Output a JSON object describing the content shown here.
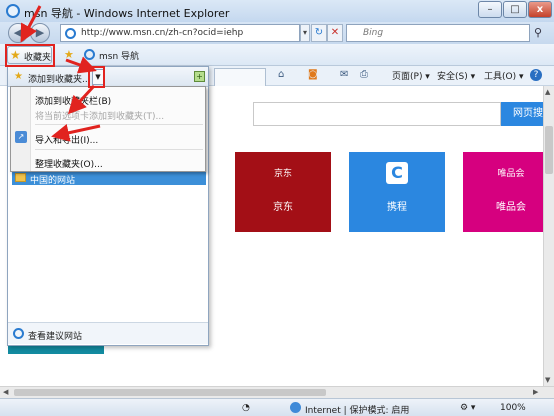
{
  "window": {
    "title": "msn 导航 - Windows Internet Explorer",
    "minimize": "–",
    "maximize": "□",
    "close": "x"
  },
  "address_bar": {
    "back": "◀",
    "forward": "▶",
    "url": "http://www.msn.cn/zh-cn?ocid=iehp",
    "dropdown": "▾",
    "refresh": "↻",
    "stop": "✕",
    "search_placeholder": "Bing",
    "search_icon": "search-icon"
  },
  "favorites_bar": {
    "favorites_button": "收藏夹",
    "site_link": "msn 导航"
  },
  "command_bar": {
    "home_icon": "home-icon",
    "feeds_icon": "rss-icon",
    "mail_icon": "mail-icon",
    "print_icon": "print-icon",
    "page": "页面(P) ▾",
    "safety": "安全(S) ▾",
    "tools": "工具(O) ▾",
    "help": "?"
  },
  "favorites_panel": {
    "add_button": "添加到收藏夹...",
    "add_arrow": "▼",
    "pin": "+",
    "folder": "中国的网站",
    "footer": "查看建议网站"
  },
  "context_menu": {
    "items": [
      {
        "label": "添加到收藏夹栏(B)",
        "enabled": true
      },
      {
        "label": "将当前选项卡添加到收藏夹(T)...",
        "enabled": false
      },
      {
        "label": "导入和导出(I)...",
        "enabled": true
      },
      {
        "label": "整理收藏夹(O)...",
        "enabled": true
      }
    ]
  },
  "page": {
    "search_button": "网页搜",
    "tiles": [
      {
        "logo": "京东",
        "caption": "京东",
        "color": "#a30f16"
      },
      {
        "logo": "C",
        "caption": "携程",
        "color": "#2b87e0"
      },
      {
        "logo": "唯品会",
        "caption": "唯品会",
        "color": "#d6007f"
      }
    ]
  },
  "status_bar": {
    "zone": "Internet | 保护模式: 启用",
    "zoom": "100%"
  },
  "colors": {
    "highlight": "#e1231f",
    "accent": "#2b87e0"
  }
}
